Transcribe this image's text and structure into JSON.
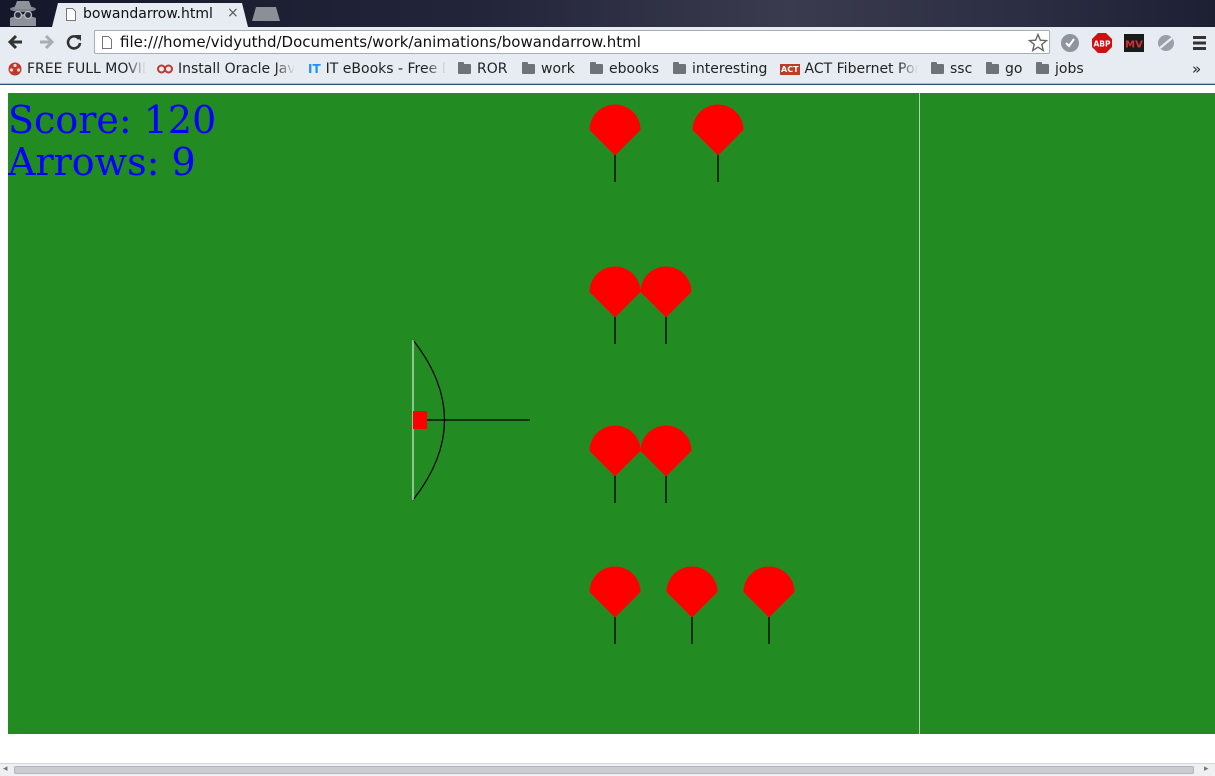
{
  "browser": {
    "tab_title": "bowandarrow.html",
    "tab_close": "×",
    "url": "file:///home/vidyuthd/Documents/work/animations/bowandarrow.html",
    "bookmarks": [
      {
        "label": "FREE FULL MOVIE",
        "icon": "reel-icon"
      },
      {
        "label": "Install Oracle Jav",
        "icon": "oracle-icon"
      },
      {
        "label": "IT eBooks - Free D",
        "icon": "it-icon"
      },
      {
        "label": "ROR",
        "icon": "folder-icon"
      },
      {
        "label": "work",
        "icon": "folder-icon"
      },
      {
        "label": "ebooks",
        "icon": "folder-icon"
      },
      {
        "label": "interesting",
        "icon": "folder-icon"
      },
      {
        "label": "ACT Fibernet Port",
        "icon": "act-icon"
      },
      {
        "label": "ssc",
        "icon": "folder-icon"
      },
      {
        "label": "go",
        "icon": "folder-icon"
      },
      {
        "label": "jobs",
        "icon": "folder-icon"
      }
    ],
    "overflow_label": "»",
    "extensions": [
      "browser-ext-icon",
      "abp-icon",
      "mv-icon",
      "no-tracking-icon",
      "menu-icon"
    ],
    "abp_label": "ABP",
    "mv_label": "MV",
    "act_label": "ACT",
    "it_label": "IT"
  },
  "game": {
    "score_text": "Score: 120",
    "arrows_text": "Arrows: 9",
    "colors": {
      "field": "#228b22",
      "hud": "#0000ff",
      "balloon": "#ff0000",
      "string": "#000000",
      "bow": "#000000",
      "bowstring": "#ffffff",
      "nock": "#ff0000"
    },
    "balloon_rows": 4,
    "balloon_counts": [
      2,
      2,
      2,
      3
    ]
  }
}
